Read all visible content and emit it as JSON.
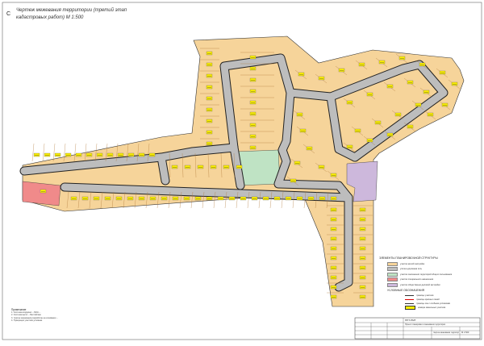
{
  "sheet": {
    "compass": "С",
    "title_line1": "Чертеж межевания территории (третий этап",
    "title_line2": "кадастровых работ) М 1:500"
  },
  "colors": {
    "residential": "#f6d49a",
    "road": "#bdbdbd",
    "road_edge": "#222222",
    "green": "#bfe3c4",
    "public": "#cdb8dc",
    "special": "#f08a8a",
    "lot_label": "#fff200",
    "lot_border": "#b07a3a"
  },
  "legend": {
    "title": "ЭЛЕМЕНТЫ ПЛАНИРОВОЧНОЙ СТРУКТУРЫ",
    "items": [
      {
        "color": "#f6d49a",
        "label": "участки жилой застройки"
      },
      {
        "color": "#bdbdbd",
        "label": "улично-дорожная сеть"
      },
      {
        "color": "#bfe3c4",
        "label": "участки озеленения территорий общего пользования"
      },
      {
        "color": "#f08a8a",
        "label": "участки специального назначения"
      },
      {
        "color": "#cdb8dc",
        "label": "участки общественно-деловой застройки"
      }
    ],
    "symbols_title": "УСЛОВНЫЕ ОБОЗНАЧЕНИЯ",
    "symbols": [
      {
        "label": "границы участков"
      },
      {
        "label": "границы красных линий"
      },
      {
        "label": "границы зон с особыми условиями"
      },
      {
        "label": "номера земельных участков"
      }
    ]
  },
  "notes": {
    "heading": "Примечание",
    "lines": [
      "1. Система координат – МСК-...",
      "2. Система высот – Балтийская",
      "3. Чертеж межевания разработан на основании ...",
      "4. Нумерация участков условная"
    ]
  },
  "stamp": {
    "code": "ППТ-ПМТ",
    "project_title": "Проект планировки и межевания территории",
    "sheet_title": "Чертеж межевания территории",
    "scale_label": "М 1:500"
  }
}
